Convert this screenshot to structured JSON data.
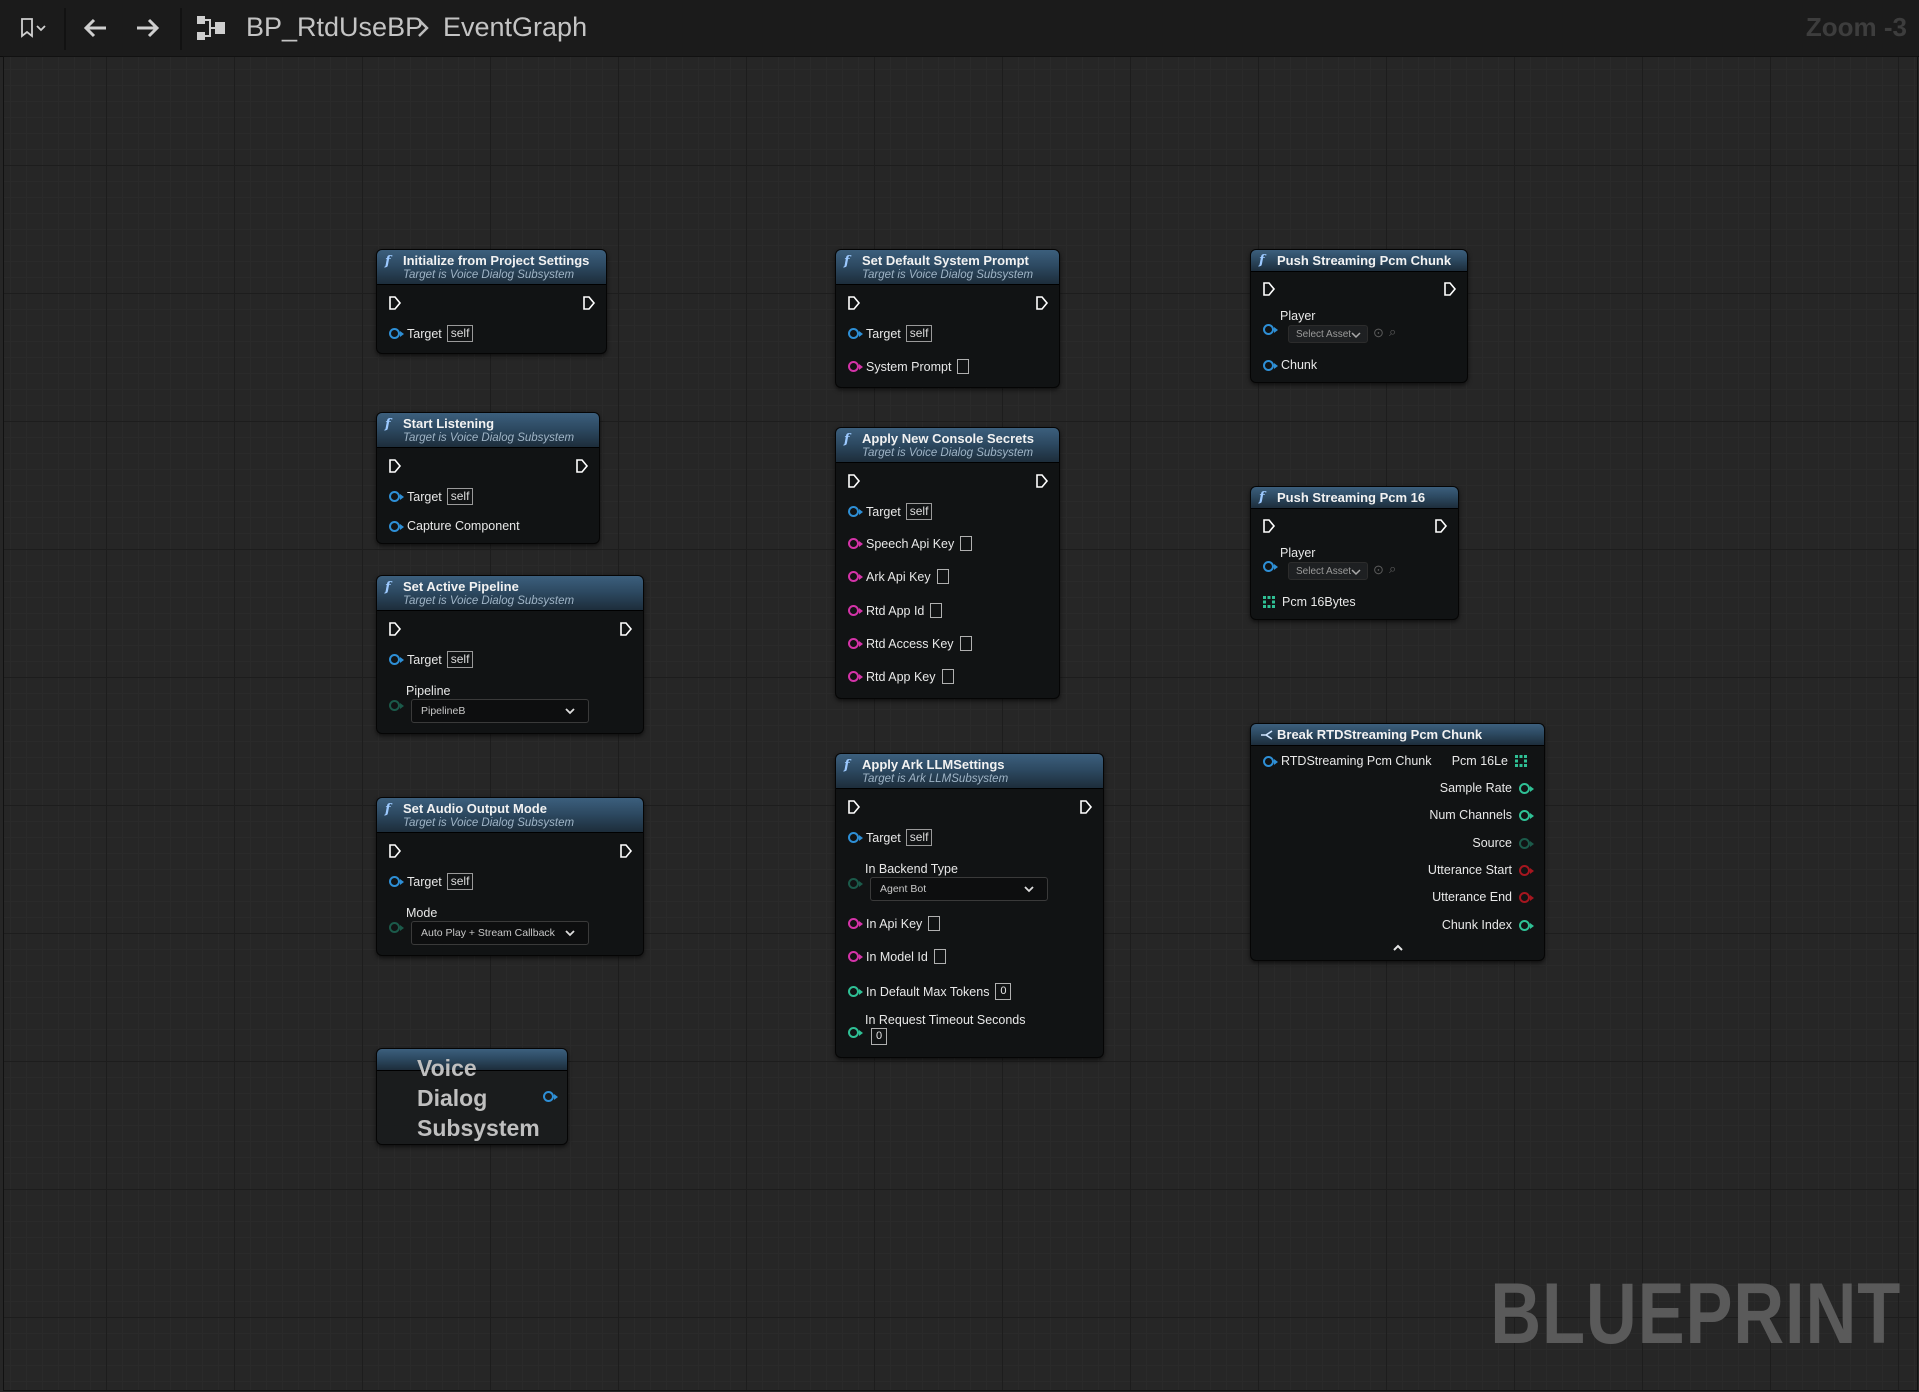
{
  "toolbar": {
    "breadcrumb_blueprint": "BP_RtdUseBP",
    "breadcrumb_graph": "EventGraph",
    "zoom": "Zoom -3"
  },
  "watermark": "BLUEPRINT",
  "colors": {
    "object_pin": "#2e8fd6",
    "string_pin": "#d433a8",
    "int_pin": "#2fc095",
    "bool_pin": "#a5161f",
    "node_header": "#2d4a62"
  },
  "nodes": {
    "init": {
      "title": "Initialize from Project Settings",
      "subtitle": "Target is Voice Dialog Subsystem",
      "target_label": "Target",
      "target_value": "self"
    },
    "start": {
      "title": "Start Listening",
      "subtitle": "Target is Voice Dialog Subsystem",
      "target_label": "Target",
      "target_value": "self",
      "capture_label": "Capture Component"
    },
    "pipeline": {
      "title": "Set Active Pipeline",
      "subtitle": "Target is Voice Dialog Subsystem",
      "target_label": "Target",
      "target_value": "self",
      "pipeline_label": "Pipeline",
      "pipeline_value": "PipelineB"
    },
    "audio": {
      "title": "Set Audio Output Mode",
      "subtitle": "Target is Voice Dialog Subsystem",
      "target_label": "Target",
      "target_value": "self",
      "mode_label": "Mode",
      "mode_value": "Auto Play + Stream Callback"
    },
    "vds": {
      "label": "Voice Dialog Subsystem"
    },
    "prompt": {
      "title": "Set Default System Prompt",
      "subtitle": "Target is Voice Dialog Subsystem",
      "target_label": "Target",
      "target_value": "self",
      "system_prompt_label": "System Prompt"
    },
    "secrets": {
      "title": "Apply New Console Secrets",
      "subtitle": "Target is Voice Dialog Subsystem",
      "target_label": "Target",
      "target_value": "self",
      "speech_api_key": "Speech Api Key",
      "ark_api_key": "Ark Api Key",
      "rtd_app_id": "Rtd App Id",
      "rtd_access_key": "Rtd Access Key",
      "rtd_app_key": "Rtd App Key"
    },
    "ark": {
      "title": "Apply Ark LLMSettings",
      "subtitle": "Target is Ark LLMSubsystem",
      "target_label": "Target",
      "target_value": "self",
      "backend_label": "In Backend Type",
      "backend_value": "Agent Bot",
      "api_key_label": "In Api Key",
      "model_id_label": "In Model Id",
      "max_tokens_label": "In Default Max Tokens",
      "max_tokens_value": "0",
      "timeout_label": "In Request Timeout Seconds",
      "timeout_value": "0"
    },
    "push_chunk": {
      "title": "Push Streaming Pcm Chunk",
      "player_label": "Player",
      "select_asset": "Select Asset",
      "chunk_label": "Chunk"
    },
    "push_pcm16": {
      "title": "Push Streaming Pcm 16",
      "player_label": "Player",
      "select_asset": "Select Asset",
      "pcm_label": "Pcm 16Bytes"
    },
    "break": {
      "title": "Break RTDStreaming Pcm Chunk",
      "input_label": "RTDStreaming Pcm Chunk",
      "outputs": [
        "Pcm 16Le",
        "Sample Rate",
        "Num Channels",
        "Source",
        "Utterance Start",
        "Utterance End",
        "Chunk Index"
      ]
    }
  }
}
